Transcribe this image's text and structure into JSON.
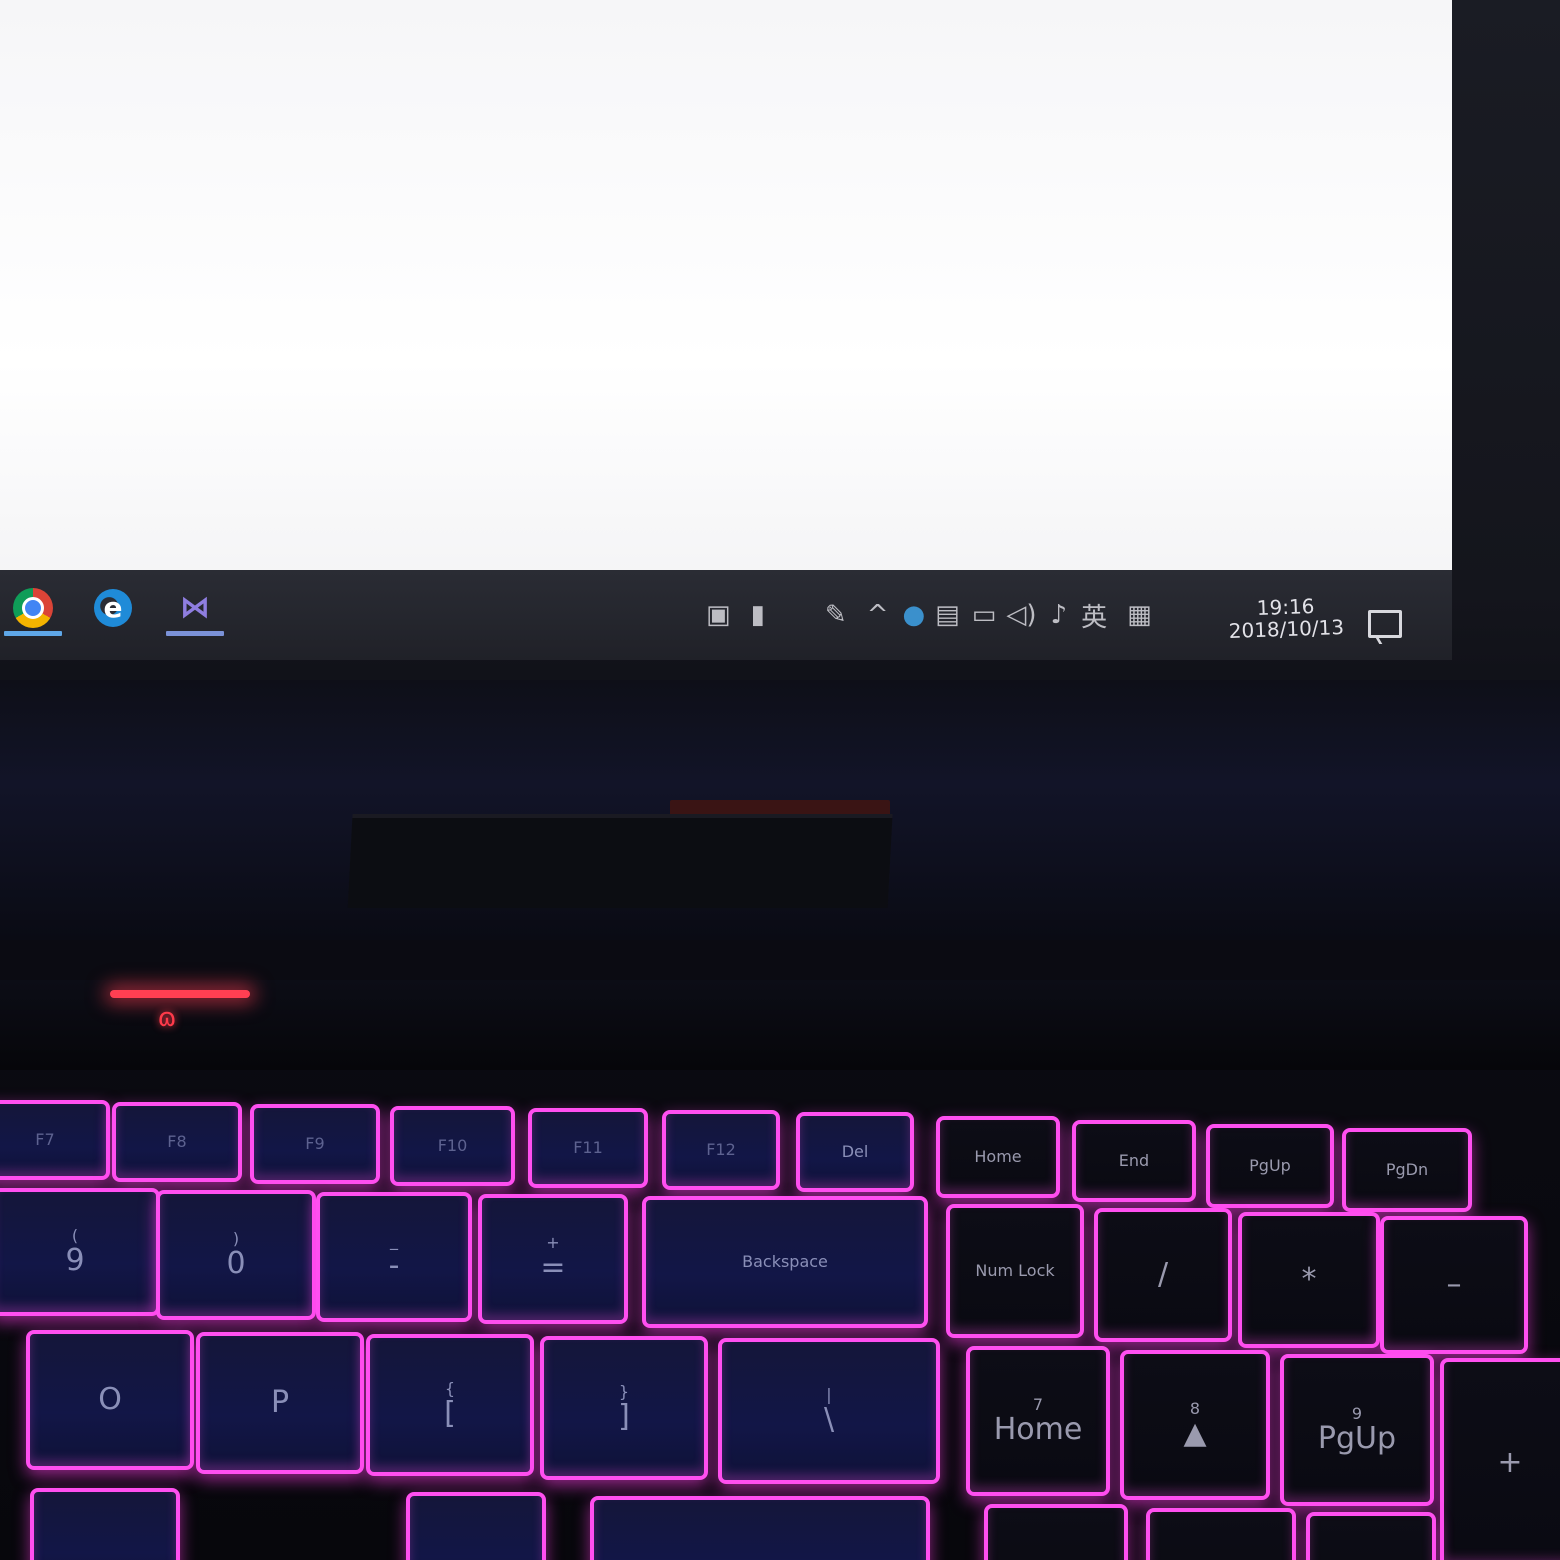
{
  "taskbar": {
    "apps": [
      {
        "name": "chrome",
        "icon": "chrome-icon"
      },
      {
        "name": "edge",
        "icon": "edge-icon"
      },
      {
        "name": "visual-studio",
        "icon": "visual-studio-icon"
      }
    ],
    "ime_label": "英",
    "clock": {
      "time": "19:16",
      "date": "2018/10/13"
    }
  },
  "keyboard": {
    "function_row": [
      "F7",
      "F8",
      "F9",
      "F10",
      "F11",
      "F12",
      "Del",
      "Home",
      "End",
      "PgUp",
      "PgDn"
    ],
    "row1": [
      "(\n9",
      ")\n0",
      "_\n-",
      "+\n=",
      "Backspace",
      "Num Lock",
      "/",
      "*",
      "–"
    ],
    "row2": [
      "O",
      "P",
      "{\n[",
      "}\n]",
      "|\n\\",
      "7\nHome",
      "8\n▲",
      "9\nPgUp",
      "+"
    ]
  },
  "colors": {
    "key_backlight": "#ff4ff0",
    "power_led": "#ff3f52",
    "taskbar": "#23242b"
  }
}
